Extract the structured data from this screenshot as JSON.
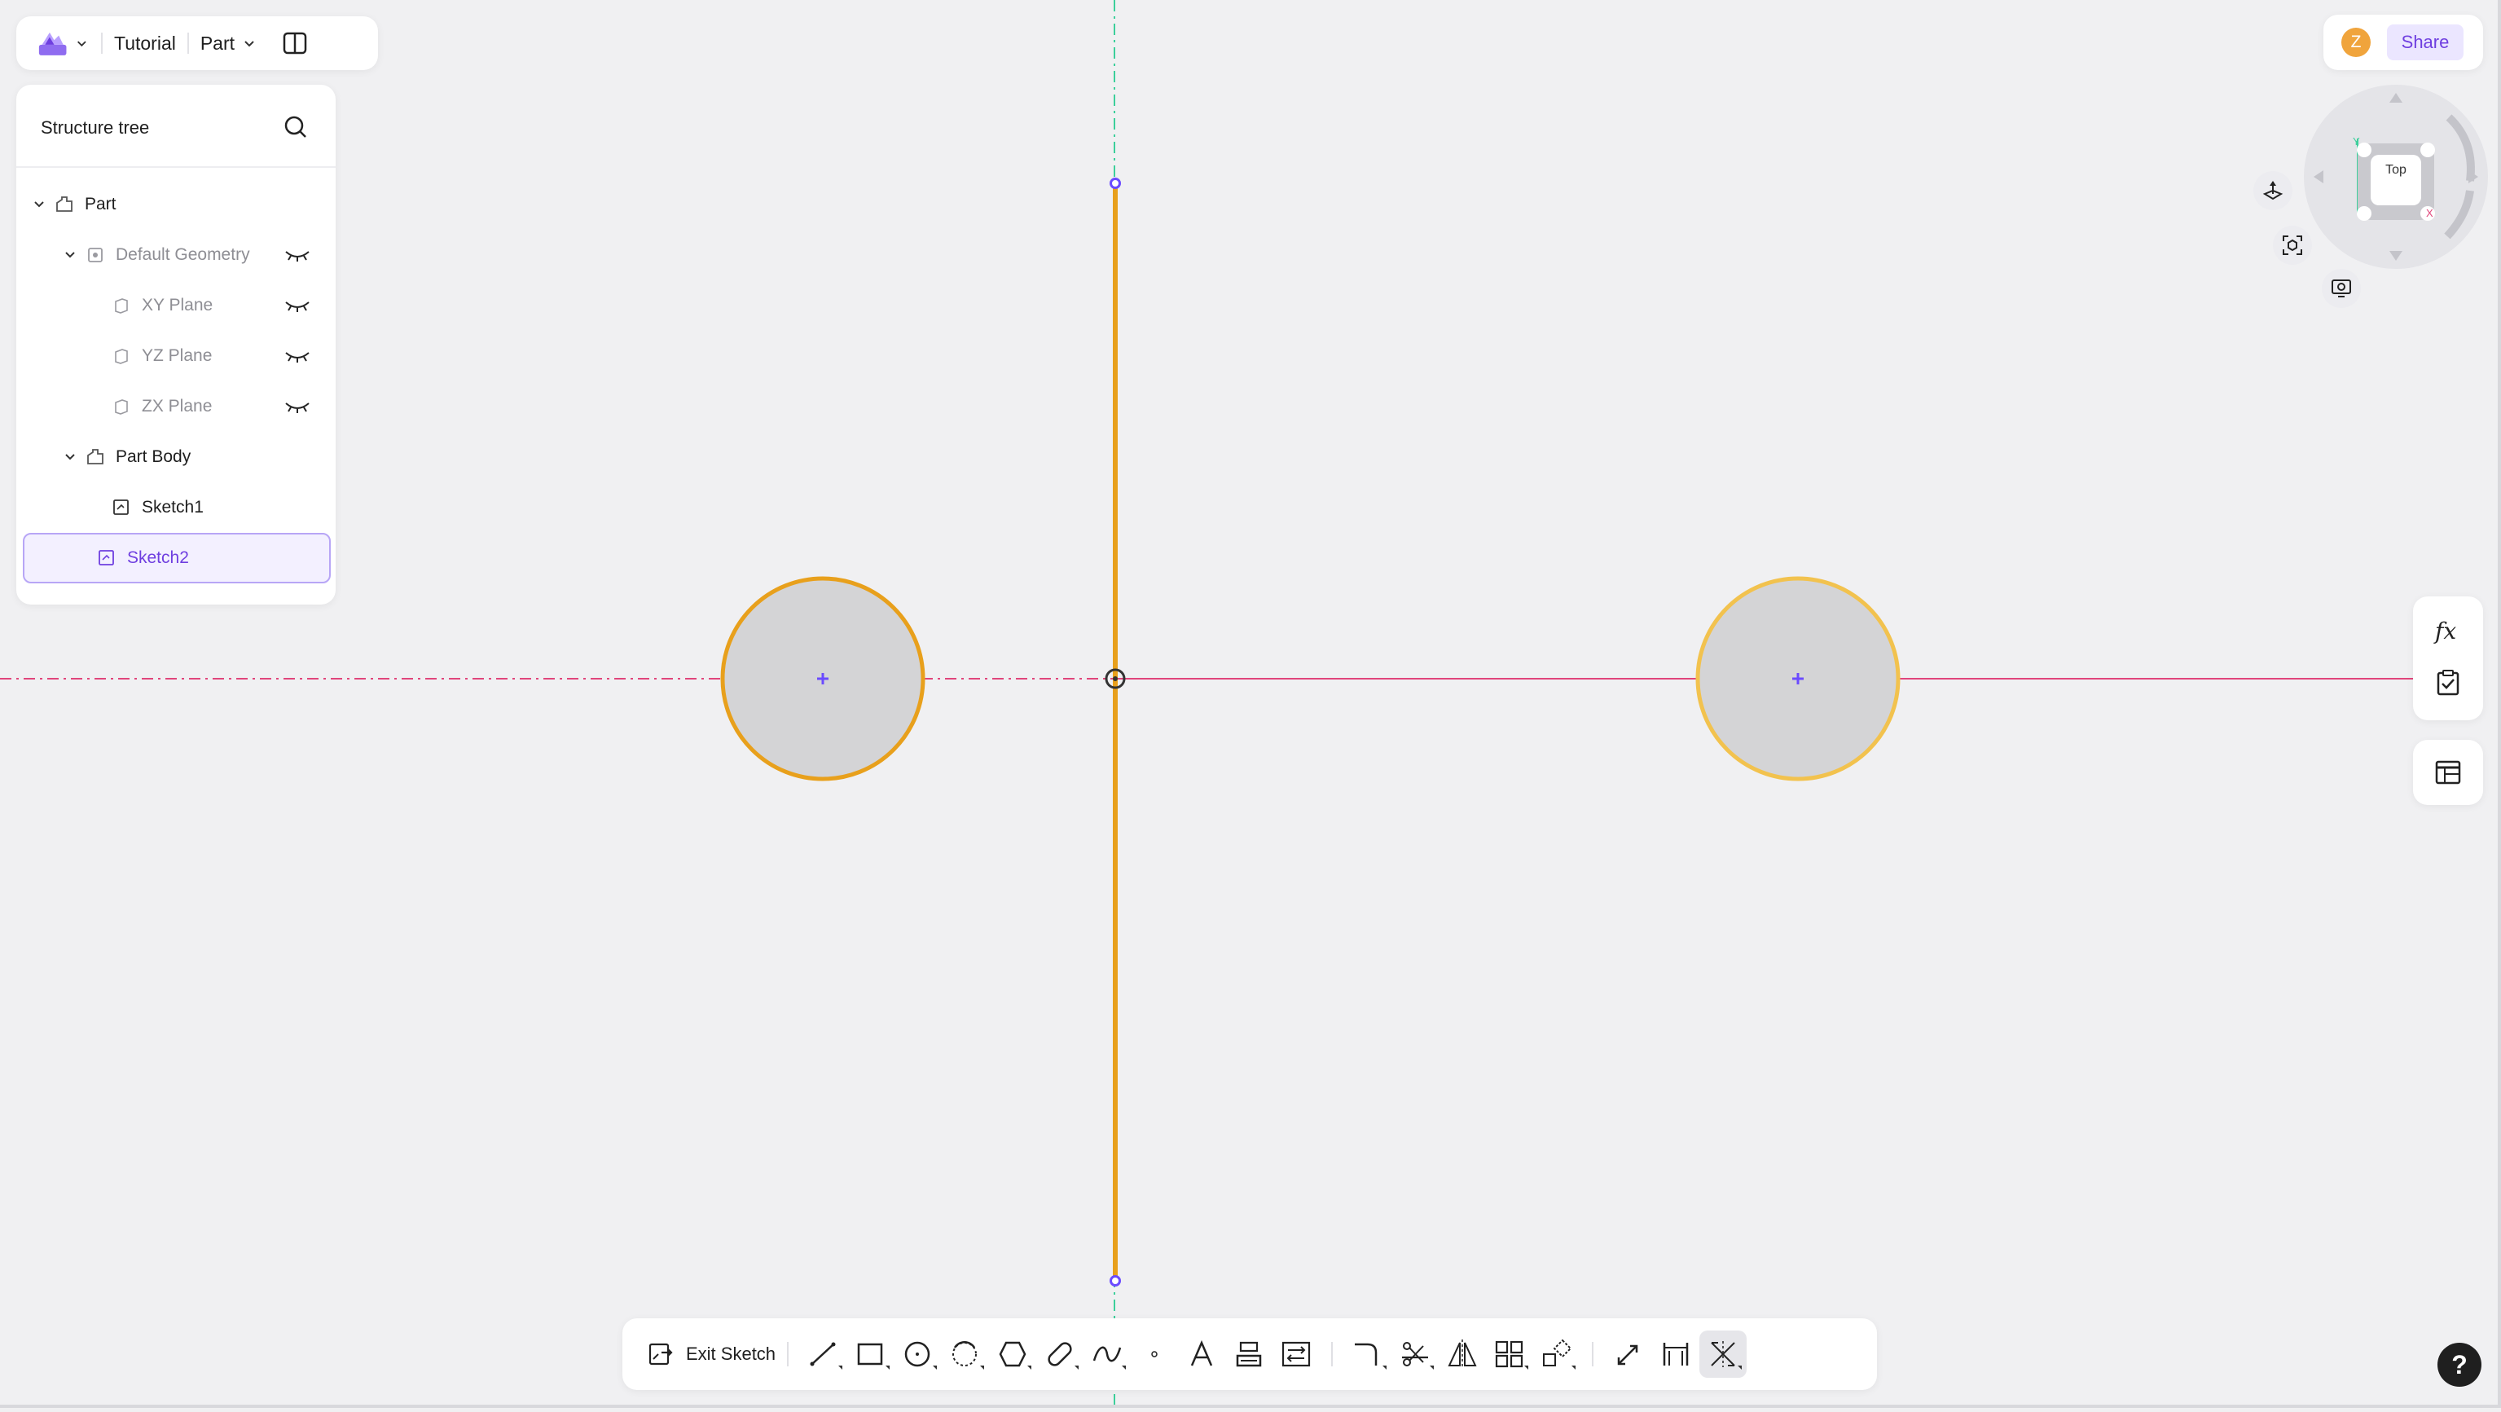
{
  "topbar": {
    "doc_title": "Tutorial",
    "part_menu": "Part"
  },
  "tree": {
    "title": "Structure tree",
    "items": [
      {
        "label": "Part"
      },
      {
        "label": "Default Geometry"
      },
      {
        "label": "XY Plane"
      },
      {
        "label": "YZ Plane"
      },
      {
        "label": "ZX Plane"
      },
      {
        "label": "Part Body"
      },
      {
        "label": "Sketch1"
      },
      {
        "label": "Sketch2"
      }
    ]
  },
  "account": {
    "avatar_initial": "Z",
    "share_label": "Share"
  },
  "viewcube": {
    "face_label": "Top",
    "axes": [
      "Y",
      "X"
    ]
  },
  "toolbar": {
    "exit_label": "Exit Sketch"
  },
  "help": {
    "label": "?"
  },
  "colors": {
    "accent": "#6f3fe0",
    "sketch_line": "#e8a01c",
    "sketch_line_light": "#f2c24e",
    "circle_fill": "#d4d4d6",
    "axis_x": "#e0457b",
    "axis_y": "#3ccf9b",
    "endpoint": "#6b4bff"
  }
}
